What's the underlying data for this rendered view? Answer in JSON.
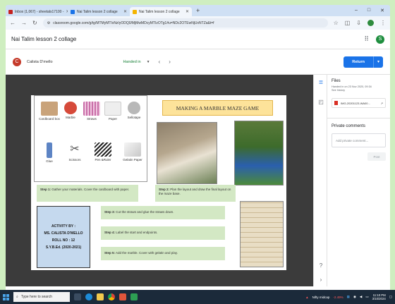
{
  "browser": {
    "tabs": [
      {
        "label": "Inbox (1,067) - sheetals17100 -",
        "favicon_color": "#c5221f",
        "active": false
      },
      {
        "label": "Nai Talim lesson 2 collage",
        "favicon_color": "#1a73e8",
        "active": false
      },
      {
        "label": "Nai Talim lesson 2 collage",
        "favicon_color": "#f4b400",
        "active": true
      }
    ],
    "new_tab": "+",
    "window_controls": [
      "–",
      "□",
      "✕"
    ],
    "url": "classroom.google.com/g/tg/MTMyMTIxNzIyODQ0/MjMwMDcyMTIzOTg1#u=NDc2OTEwNjUxNTZa&t=f"
  },
  "app": {
    "title": "Nai Talim lesson 2 collage",
    "user_initial": "S"
  },
  "submission": {
    "student_initial": "C",
    "student_name": "Calista D'mello",
    "status": "Handed in",
    "return_label": "Return"
  },
  "files_panel": {
    "title": "Files",
    "meta_line1": "Handed in on 23 Nov 2020, 09:34",
    "meta_line2": "See history",
    "file_name": "IMG-20201123-WA00...",
    "private_comments_title": "Private comments",
    "comment_placeholder": "Add private comment...",
    "post_label": "Post"
  },
  "slide": {
    "title": "MAKING A MARBLE MAZE GAME",
    "materials": [
      {
        "label": "Cardboard box",
        "color": "#c9a37a"
      },
      {
        "label": "Marble",
        "color": "#d64a3a"
      },
      {
        "label": "Straws",
        "color": "#c96ea8"
      },
      {
        "label": "Paper",
        "color": "#eeeeee"
      },
      {
        "label": "Sellotape",
        "color": "#b8b8b8"
      },
      {
        "label": "Glue",
        "color": "#5d84c4"
      },
      {
        "label": "Scissors",
        "color": "#555555"
      },
      {
        "label": "Pen &Ruler",
        "color": "#222222"
      },
      {
        "label": "Gelatin Paper",
        "color": "#dcdcdc"
      }
    ],
    "step1_bold": "Step 1:",
    "step1_text": " Gather your materials. Cover the cardboard with paper.",
    "step2_bold": "Step 2:",
    "step2_text": " Plan the layout and draw the final layout on the maze base.",
    "step3_bold": "Step 3:",
    "step3_text": " Cut the straws and glue the straws down.",
    "step4_bold": "Step 4:",
    "step4_text": " Label the start and endpoints.",
    "step5_bold": "Step 5:",
    "step5_text": " Add the marble. Cover with gelatin and play.",
    "activity_lines": [
      "ACTIVITY BY :",
      "MS. CALISTA D'MELLO",
      "ROLL NO : 12",
      "S.Y.B.Ed. (2020-2021)"
    ]
  },
  "taskbar": {
    "search_placeholder": "Type here to search",
    "stock_name": "Nifty midcap",
    "stock_change": "-2.49%",
    "time": "11:10 PM",
    "date": "3/10/2024"
  }
}
